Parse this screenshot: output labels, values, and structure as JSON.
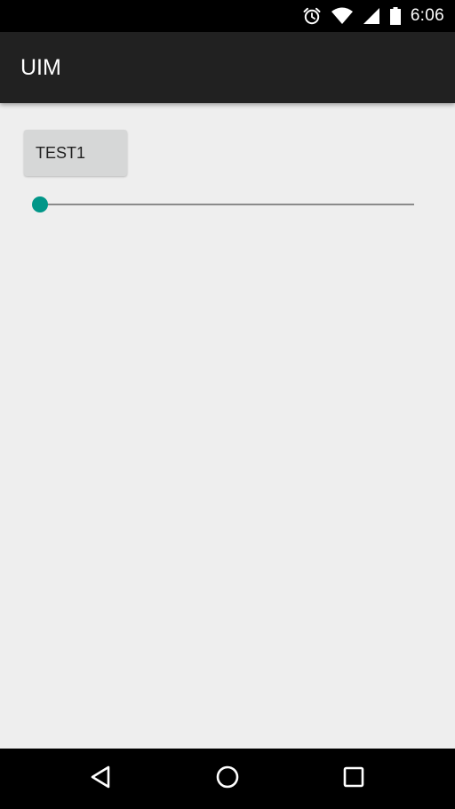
{
  "status_bar": {
    "time": "6:06",
    "icons": [
      "alarm-icon",
      "wifi-icon",
      "cell-signal-icon",
      "battery-icon"
    ]
  },
  "app_bar": {
    "title": "UIM",
    "background": "#212121"
  },
  "content": {
    "button_test1_label": "TEST1",
    "seekbar": {
      "progress": 0,
      "accent": "#009688"
    }
  },
  "nav_bar": {
    "icons": [
      "back-icon",
      "home-icon",
      "recents-icon"
    ]
  }
}
